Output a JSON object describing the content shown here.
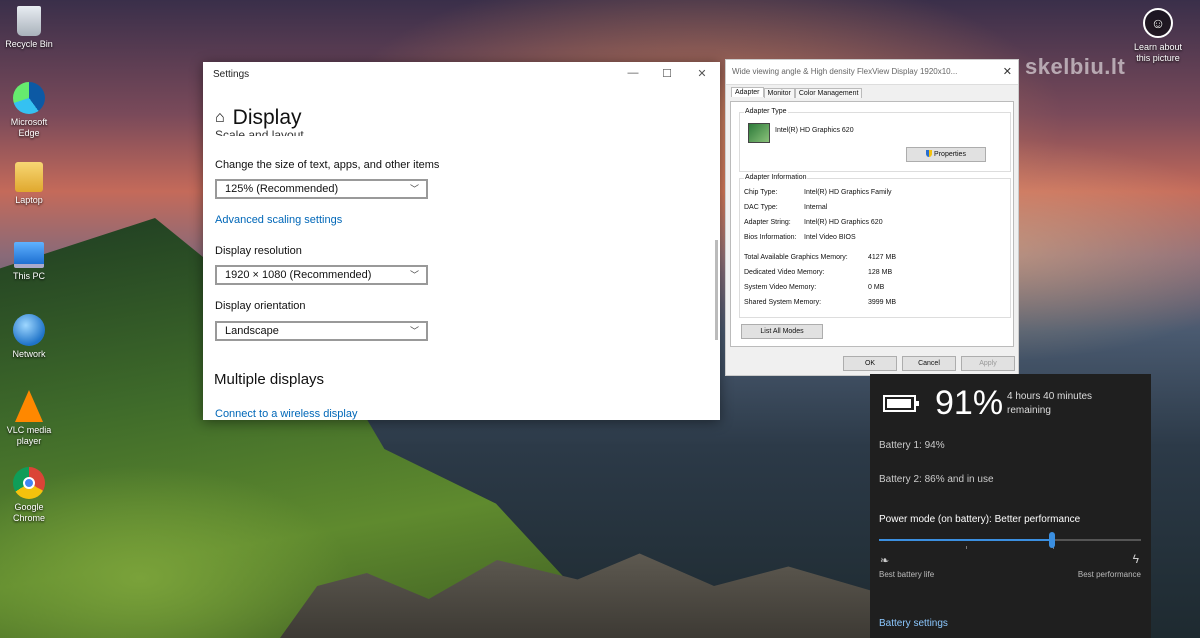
{
  "desktop": {
    "icons": [
      {
        "label": "Recycle Bin",
        "icon": "recycle-bin-icon"
      },
      {
        "label": "Microsoft Edge",
        "icon": "edge-icon"
      },
      {
        "label": "Laptop",
        "icon": "user-folder-icon"
      },
      {
        "label": "This PC",
        "icon": "computer-icon"
      },
      {
        "label": "Network",
        "icon": "network-icon"
      },
      {
        "label": "VLC media player",
        "icon": "vlc-icon"
      },
      {
        "label": "Google Chrome",
        "icon": "chrome-icon"
      }
    ],
    "learn_about": "Learn about this picture",
    "watermark": "skelbiu.lt"
  },
  "settings": {
    "window_title": "Settings",
    "page_title": "Display",
    "cut_heading": "Scale and layout",
    "scale_label": "Change the size of text, apps, and other items",
    "scale_value": "125% (Recommended)",
    "advanced_scaling": "Advanced scaling settings",
    "resolution_label": "Display resolution",
    "resolution_value": "1920 × 1080 (Recommended)",
    "orientation_label": "Display orientation",
    "orientation_value": "Landscape",
    "multiple_displays": "Multiple displays",
    "wireless_link": "Connect to a wireless display",
    "minimize_glyph": "—",
    "maximize_glyph": "☐",
    "close_glyph": "✕"
  },
  "adapter_dialog": {
    "title": "Wide viewing angle & High density FlexView Display 1920x10...",
    "close_glyph": "✕",
    "tabs": [
      "Adapter",
      "Monitor",
      "Color Management"
    ],
    "adapter_type_label": "Adapter Type",
    "adapter_name": "Intel(R) HD Graphics 620",
    "properties_button": "Properties",
    "adapter_info_label": "Adapter Information",
    "info": [
      {
        "k": "Chip Type:",
        "v": "Intel(R) HD Graphics Family"
      },
      {
        "k": "DAC Type:",
        "v": "Internal"
      },
      {
        "k": "Adapter String:",
        "v": "Intel(R) HD Graphics 620"
      },
      {
        "k": "Bios Information:",
        "v": "Intel Video BIOS"
      }
    ],
    "memory": [
      {
        "k": "Total Available Graphics Memory:",
        "v": "4127 MB"
      },
      {
        "k": "Dedicated Video Memory:",
        "v": "128 MB"
      },
      {
        "k": "System Video Memory:",
        "v": "0 MB"
      },
      {
        "k": "Shared System Memory:",
        "v": "3999 MB"
      }
    ],
    "list_all_modes": "List All Modes",
    "ok": "OK",
    "cancel": "Cancel",
    "apply": "Apply"
  },
  "battery": {
    "percent": "91%",
    "remaining": "4 hours 40 minutes remaining",
    "battery1": "Battery 1: 94%",
    "battery2": "Battery 2: 86% and in use",
    "power_mode": "Power mode (on battery): Better performance",
    "slider_level": 0.66,
    "best_battery": "Best battery life",
    "best_performance": "Best performance",
    "settings_link": "Battery settings",
    "accent": "#3b8fe0"
  }
}
